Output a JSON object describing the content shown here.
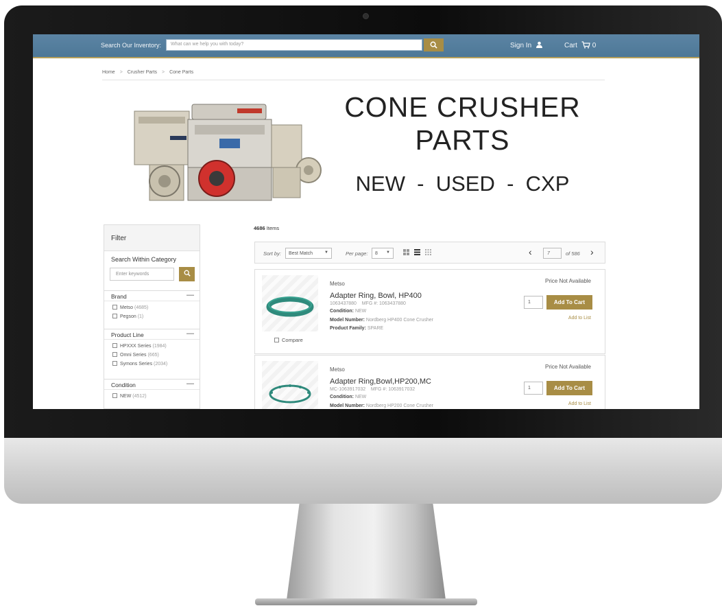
{
  "header": {
    "search_label": "Search Our Inventory:",
    "search_placeholder": "What can we help you with today?",
    "sign_in": "Sign In",
    "cart_label": "Cart",
    "cart_count": "0"
  },
  "breadcrumb": [
    "Home",
    "Crusher Parts",
    "Cone Parts"
  ],
  "hero": {
    "title_line1": "CONE CRUSHER",
    "title_line2": "PARTS",
    "subtitle": "NEW  -  USED  -  CXP"
  },
  "filter": {
    "title": "Filter",
    "search_within": "Search Within Category",
    "keyword_placeholder": "Enter keywords",
    "sections": [
      {
        "name": "Brand",
        "options": [
          {
            "label": "Metso",
            "count": "(4685)"
          },
          {
            "label": "Pegson",
            "count": "(1)"
          }
        ]
      },
      {
        "name": "Product Line",
        "options": [
          {
            "label": "HPXXX Series",
            "count": "(1984)"
          },
          {
            "label": "Omni Series",
            "count": "(665)"
          },
          {
            "label": "Symons Series",
            "count": "(2034)"
          }
        ]
      },
      {
        "name": "Condition",
        "options": [
          {
            "label": "NEW",
            "count": "(4512)"
          }
        ]
      }
    ]
  },
  "results": {
    "count": "4686",
    "count_suffix": "Items",
    "sort_label": "Sort by:",
    "sort_value": "Best Match",
    "per_page_label": "Per page:",
    "per_page_value": "8",
    "page_current": "7",
    "page_total": "of 586"
  },
  "products": [
    {
      "brand": "Metso",
      "name": "Adapter Ring, Bowl, HP400",
      "ids": "1063437880    MFG #: 1063437880",
      "condition_label": "Condition:",
      "condition": "NEW",
      "model_label": "Model Number:",
      "model": "Nordberg HP400 Cone Crusher",
      "family_label": "Product Family:",
      "family": "SPARE",
      "price": "Price Not Available",
      "qty": "1",
      "add_to_cart": "Add To Cart",
      "add_to_list": "Add to List",
      "compare": "Compare"
    },
    {
      "brand": "Metso",
      "name": "Adapter Ring,Bowl,HP200,MC",
      "ids": "MC-1063917032    MFG #: 1063917032",
      "condition_label": "Condition:",
      "condition": "NEW",
      "model_label": "Model Number:",
      "model": "Nordberg HP200 Cone Crusher",
      "price": "Price Not Available",
      "qty": "1",
      "add_to_cart": "Add To Cart",
      "add_to_list": "Add to List"
    }
  ],
  "colors": {
    "header_blue": "#5b84a4",
    "accent_gold": "#a88d45",
    "ring_green": "#2f8a7c"
  }
}
